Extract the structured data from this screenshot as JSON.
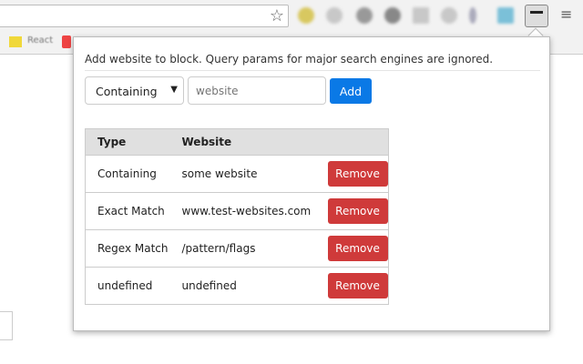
{
  "bookmarks": {
    "items": [
      "React"
    ]
  },
  "popup": {
    "description": "Add website to block. Query params for major search engines are ignored.",
    "match_type": "Containing",
    "website_placeholder": "website",
    "add_label": "Add",
    "table": {
      "headers": [
        "Type",
        "Website"
      ],
      "rows": [
        {
          "type": "Containing",
          "website": "some website",
          "action": "Remove"
        },
        {
          "type": "Exact Match",
          "website": "www.test-websites.com",
          "action": "Remove"
        },
        {
          "type": "Regex Match",
          "website": "/pattern/flags",
          "action": "Remove"
        },
        {
          "type": "undefined",
          "website": "undefined",
          "action": "Remove"
        }
      ]
    }
  }
}
